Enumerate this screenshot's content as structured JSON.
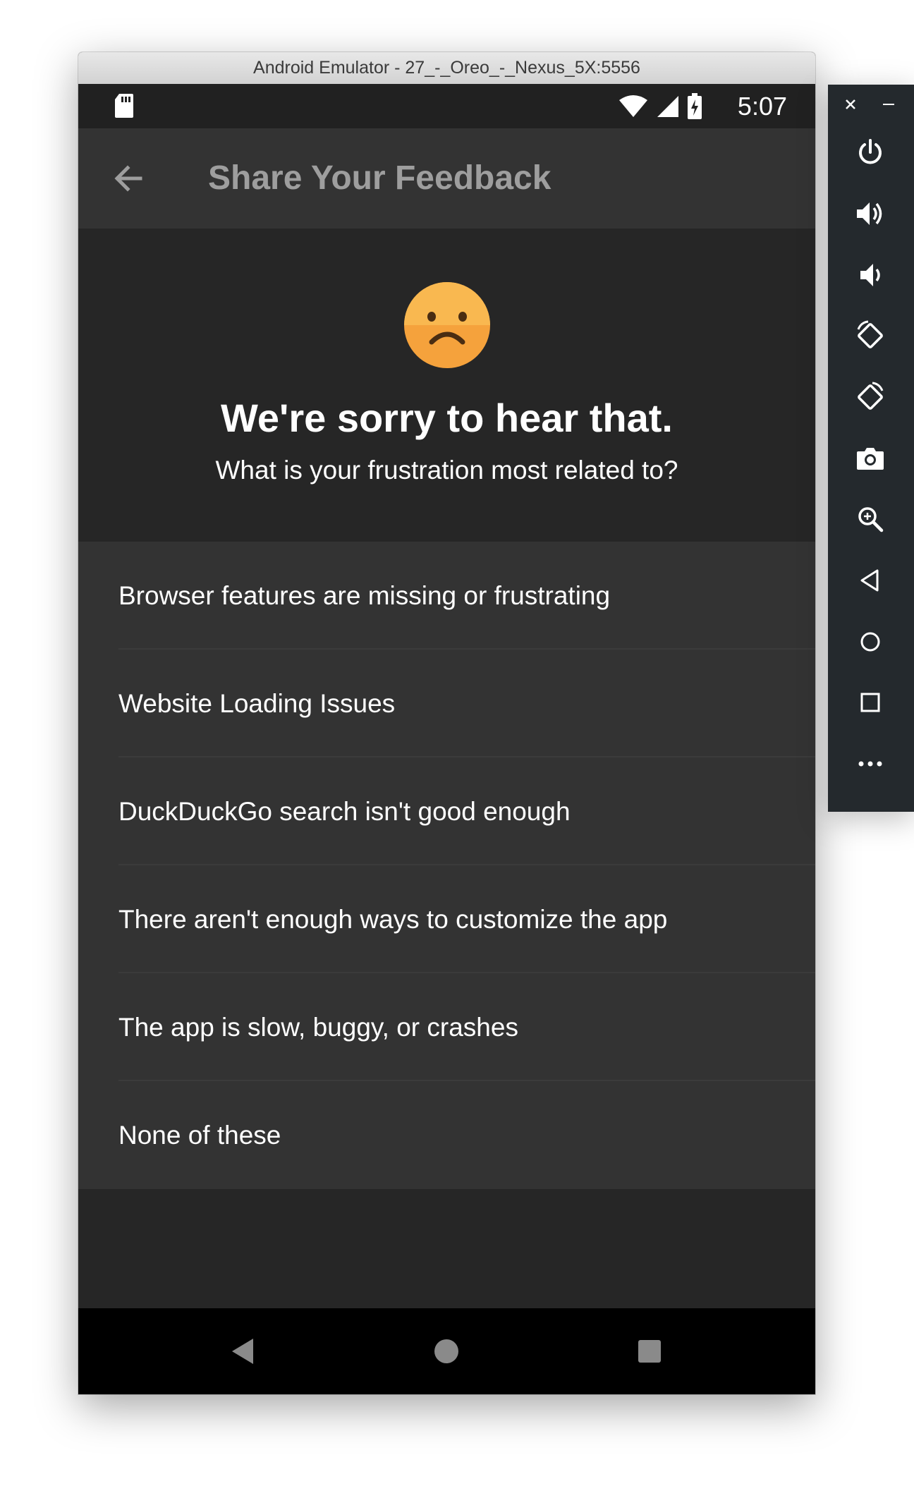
{
  "window": {
    "title": "Android Emulator - 27_-_Oreo_-_Nexus_5X:5556"
  },
  "status_bar": {
    "time": "5:07",
    "icons": [
      "sd-card-icon",
      "wifi-icon",
      "cell-signal-icon",
      "battery-charging-icon"
    ]
  },
  "app_bar": {
    "title": "Share Your Feedback",
    "back_icon": "arrow-left-icon"
  },
  "header": {
    "emoji": "frowning-face",
    "heading": "We're sorry to hear that.",
    "subheading": "What is your frustration most related to?"
  },
  "options": [
    {
      "label": "Browser features are missing or frustrating"
    },
    {
      "label": "Website Loading Issues"
    },
    {
      "label": "DuckDuckGo search isn't good enough"
    },
    {
      "label": "There aren't enough ways to customize the app"
    },
    {
      "label": "The app is slow, buggy, or crashes"
    },
    {
      "label": "None of these"
    }
  ],
  "nav_bar": {
    "buttons": [
      "nav-back-icon",
      "nav-home-icon",
      "nav-recents-icon"
    ]
  },
  "side_panel": {
    "controls": [
      "power-icon",
      "volume-up-icon",
      "volume-down-icon",
      "rotate-left-icon",
      "rotate-right-icon",
      "camera-icon",
      "zoom-icon",
      "back-icon",
      "home-icon",
      "overview-icon",
      "more-icon"
    ]
  },
  "colors": {
    "app_bar": "#333333",
    "background": "#262626",
    "emoji": "#f5a23c",
    "title_text": "#9e9e9e"
  }
}
